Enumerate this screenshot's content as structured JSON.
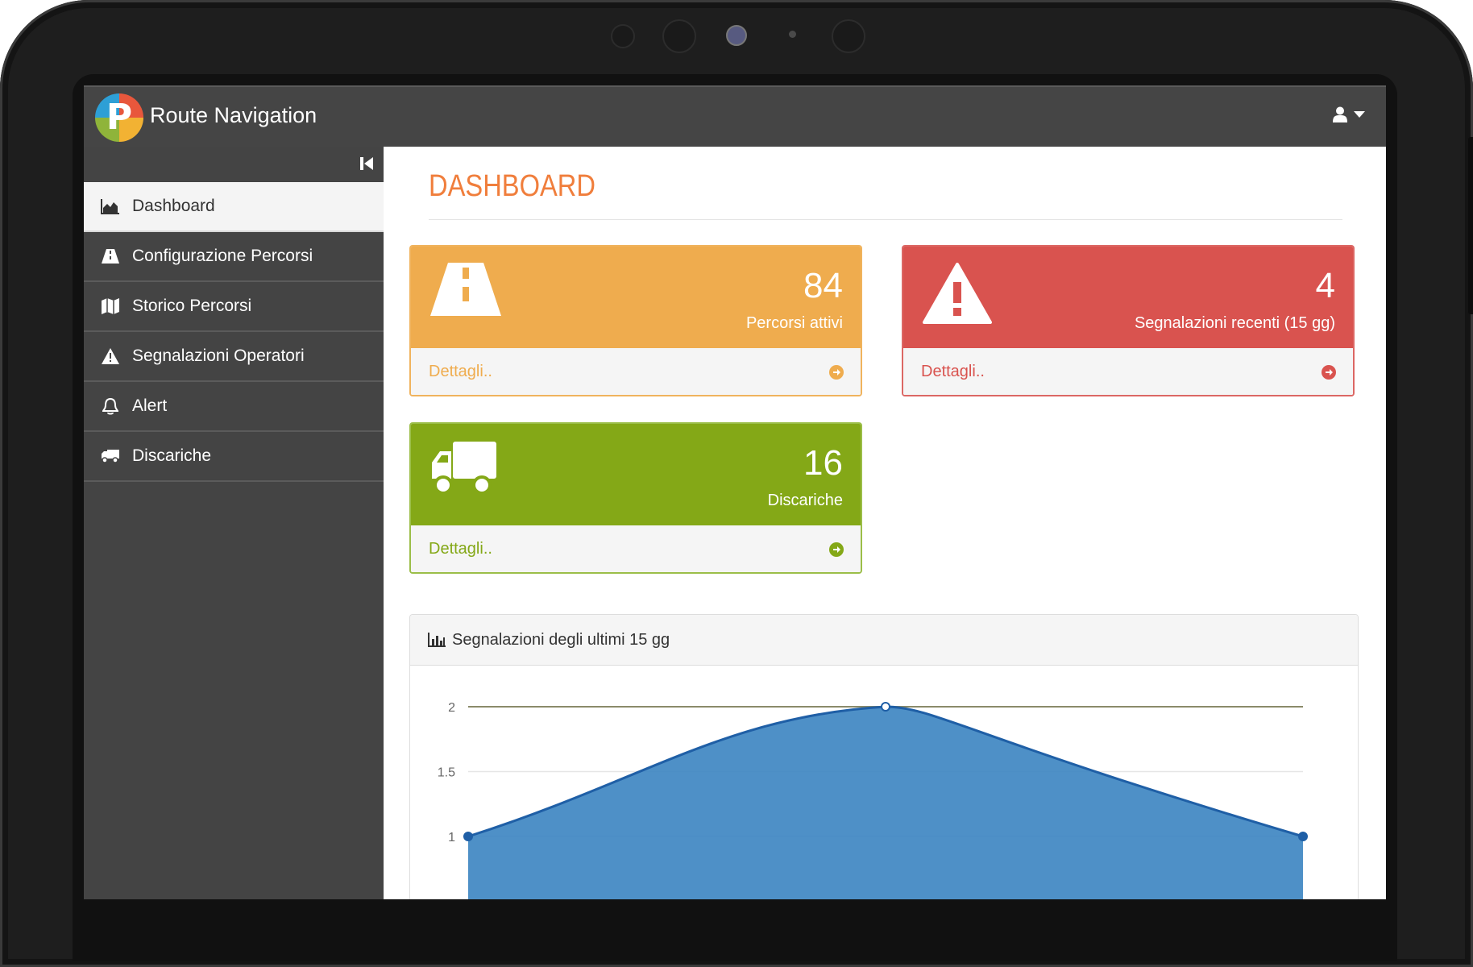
{
  "app": {
    "title": "Route Navigation",
    "logo_letter": "P"
  },
  "header": {
    "user_icon": "user-icon",
    "caret_icon": "caret-down-icon"
  },
  "sidebar": {
    "items": [
      {
        "label": "Dashboard",
        "icon": "area-chart-icon",
        "active": true
      },
      {
        "label": "Configurazione Percorsi",
        "icon": "road-icon",
        "active": false
      },
      {
        "label": "Storico Percorsi",
        "icon": "map-icon",
        "active": false
      },
      {
        "label": "Segnalazioni Operatori",
        "icon": "warning-icon",
        "active": false
      },
      {
        "label": "Alert",
        "icon": "bell-icon",
        "active": false
      },
      {
        "label": "Discariche",
        "icon": "truck-icon",
        "active": false
      }
    ]
  },
  "main": {
    "title": "DASHBOARD",
    "cards": [
      {
        "count": "84",
        "label": "Percorsi attivi",
        "link": "Dettagli..",
        "icon": "road-icon",
        "color": "#efac4e"
      },
      {
        "count": "4",
        "label": "Segnalazioni recenti (15 gg)",
        "link": "Dettagli..",
        "icon": "warning-icon",
        "color": "#d9534f"
      },
      {
        "count": "16",
        "label": "Discariche",
        "link": "Dettagli..",
        "icon": "truck-icon",
        "color": "#84a817"
      }
    ],
    "panel_title": "Segnalazioni degli ultimi 15 gg"
  },
  "chart_data": {
    "type": "area",
    "title": "Segnalazioni degli ultimi 15 gg",
    "y_ticks": [
      "2",
      "1.5",
      "1"
    ],
    "ylim": [
      1,
      2
    ],
    "series": [
      {
        "values": [
          1,
          2,
          1
        ],
        "color": "#3f87c2"
      }
    ],
    "grid": true
  }
}
